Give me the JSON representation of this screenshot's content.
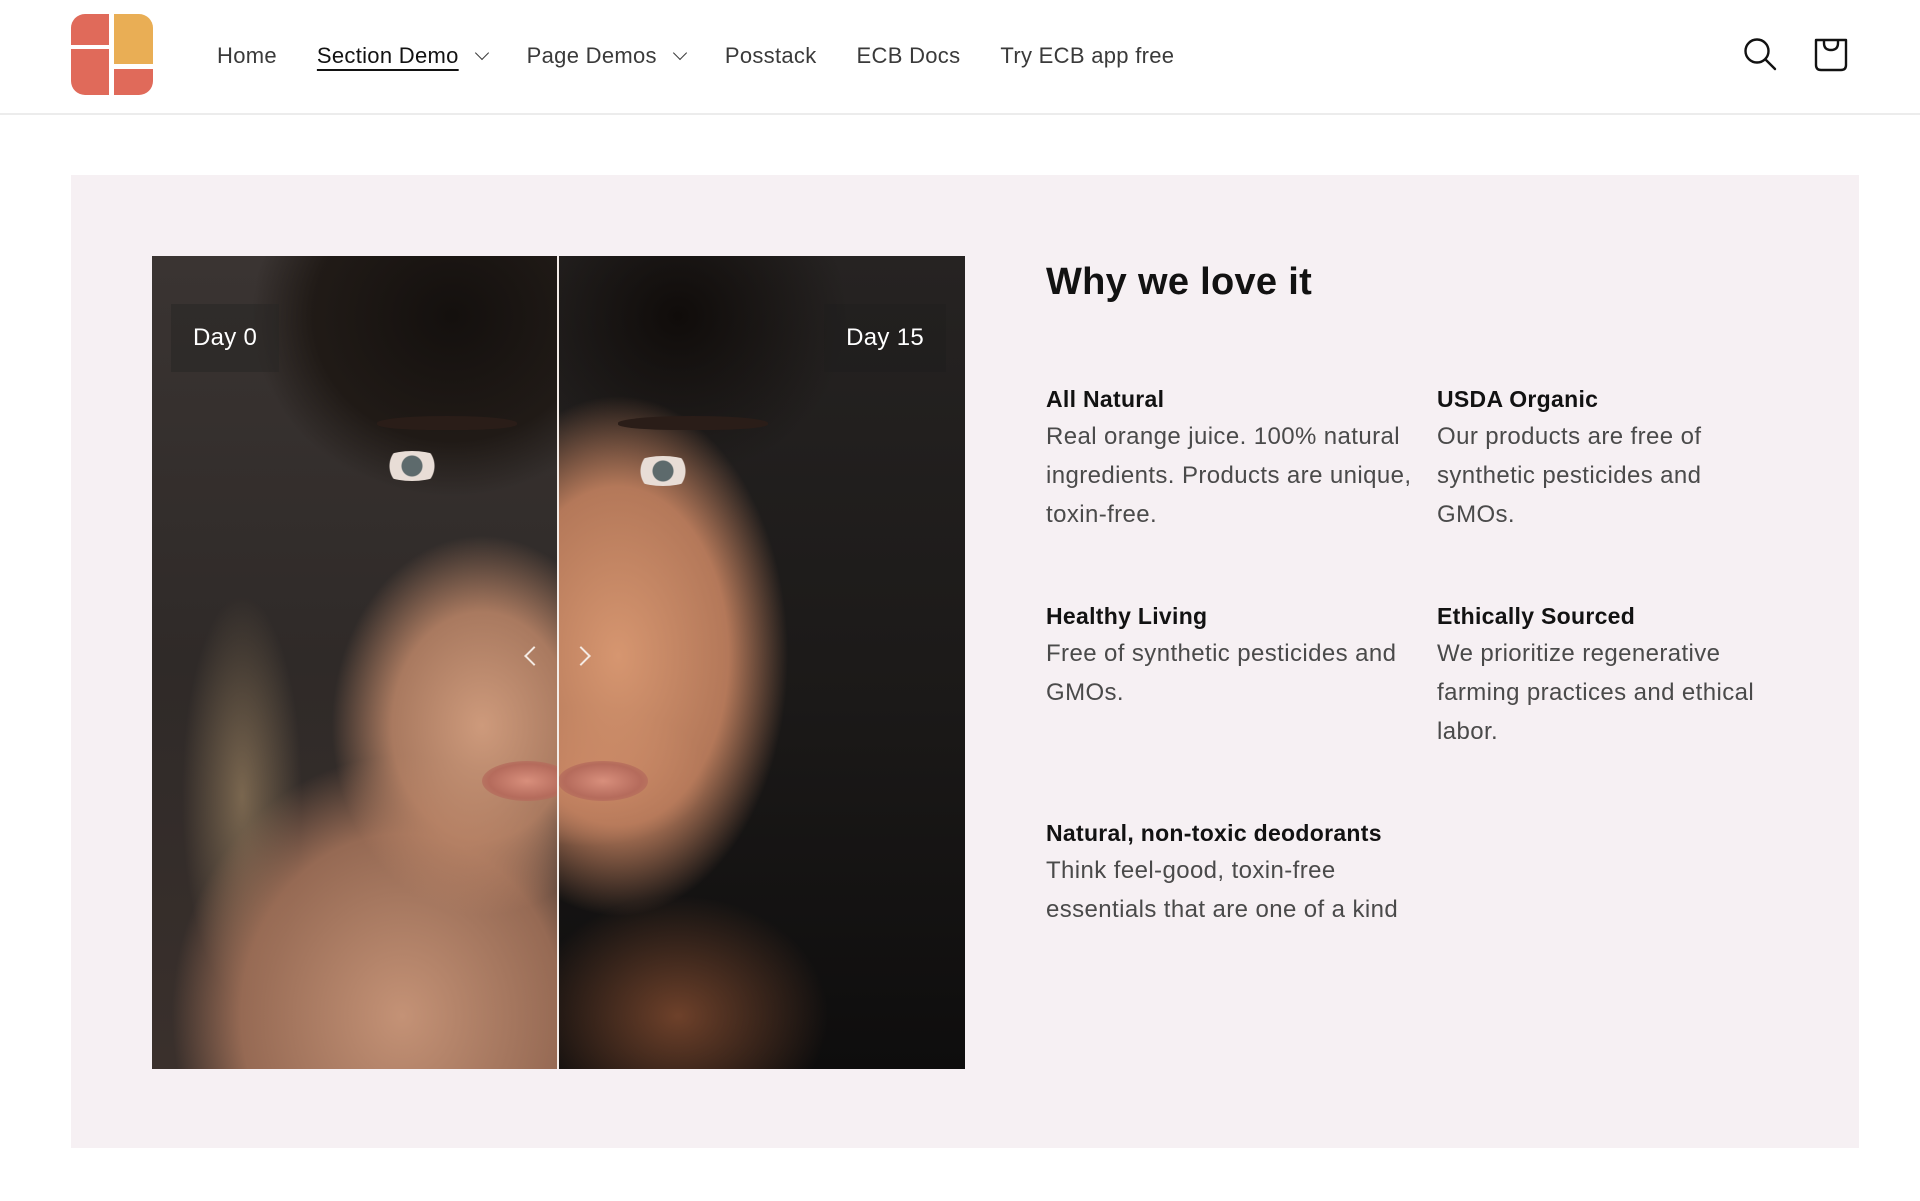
{
  "header": {
    "logo_alt": "ECB logo",
    "nav": [
      {
        "label": "Home",
        "has_dropdown": false,
        "active": false
      },
      {
        "label": "Section Demo",
        "has_dropdown": true,
        "active": true
      },
      {
        "label": "Page Demos",
        "has_dropdown": true,
        "active": false
      },
      {
        "label": "Posstack",
        "has_dropdown": false,
        "active": false
      },
      {
        "label": "ECB Docs",
        "has_dropdown": false,
        "active": false
      },
      {
        "label": "Try ECB app free",
        "has_dropdown": false,
        "active": false
      }
    ],
    "icons": {
      "search": "search-icon",
      "cart": "cart-icon"
    }
  },
  "compare": {
    "before_label": "Day 0",
    "after_label": "Day 15",
    "slider_position": 0.5,
    "icons": {
      "left": "chevron-left-icon",
      "right": "chevron-right-icon"
    }
  },
  "content": {
    "title": "Why we love it",
    "features": [
      {
        "title": "All Natural",
        "text": "Real orange juice. 100% natural ingredients. Products are unique, toxin-free."
      },
      {
        "title": "USDA Organic",
        "text": "Our products are free of synthetic pesticides and GMOs."
      },
      {
        "title": "Healthy Living",
        "text": "Free of synthetic pesticides and GMOs."
      },
      {
        "title": "Ethically Sourced",
        "text": "We prioritize regenerative farming practices and ethical labor."
      },
      {
        "title": "Natural, non-toxic deodorants",
        "text": "Think feel-good, toxin-free essentials that are one of a kind"
      }
    ]
  },
  "colors": {
    "logo_red": "#e06a5a",
    "logo_yellow": "#e9ae55",
    "panel_bg": "#f6f0f3",
    "text_primary": "#121212",
    "text_secondary": "#4a4a4a"
  }
}
